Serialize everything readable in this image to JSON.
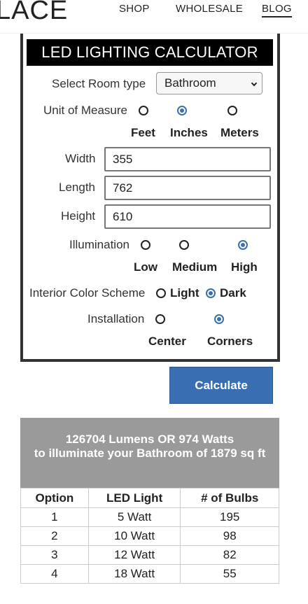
{
  "header": {
    "logo": "LACE",
    "nav": [
      "SHOP",
      "WHOLESALE",
      "BLOG"
    ]
  },
  "calculator": {
    "title": "LED LIGHTING CALCULATOR",
    "room_type_label": "Select Room type",
    "room_type_value": "Bathroom",
    "unit_label": "Unit of Measure",
    "units": [
      {
        "label": "Feet",
        "selected": false
      },
      {
        "label": "Inches",
        "selected": true
      },
      {
        "label": "Meters",
        "selected": false
      }
    ],
    "width_label": "Width",
    "width_value": "355",
    "length_label": "Length",
    "length_value": "762",
    "height_label": "Height",
    "height_value": "610",
    "illumination_label": "Illumination",
    "illumination": [
      {
        "label": "Low",
        "selected": false
      },
      {
        "label": "Medium",
        "selected": false
      },
      {
        "label": "High",
        "selected": true
      }
    ],
    "color_scheme_label": "Interior Color Scheme",
    "color_scheme": [
      {
        "label": "Light",
        "selected": false
      },
      {
        "label": "Dark",
        "selected": true
      }
    ],
    "installation_label": "Installation",
    "installation": [
      {
        "label": "Center",
        "selected": false
      },
      {
        "label": "Corners",
        "selected": true
      }
    ],
    "calculate_label": "Calculate"
  },
  "result": {
    "line1": "126704 Lumens OR 974 Watts",
    "line2": "to illuminate your Bathroom of 1879 sq ft"
  },
  "table": {
    "headers": [
      "Option",
      "LED Light",
      "# of Bulbs"
    ],
    "rows": [
      [
        "1",
        "5 Watt",
        "195"
      ],
      [
        "2",
        "10 Watt",
        "98"
      ],
      [
        "3",
        "12 Watt",
        "82"
      ],
      [
        "4",
        "18 Watt",
        "55"
      ]
    ]
  },
  "colors": {
    "accent": "#3a6eb2",
    "title_bar": "#000000",
    "result_bg": "#9a9a9a"
  }
}
